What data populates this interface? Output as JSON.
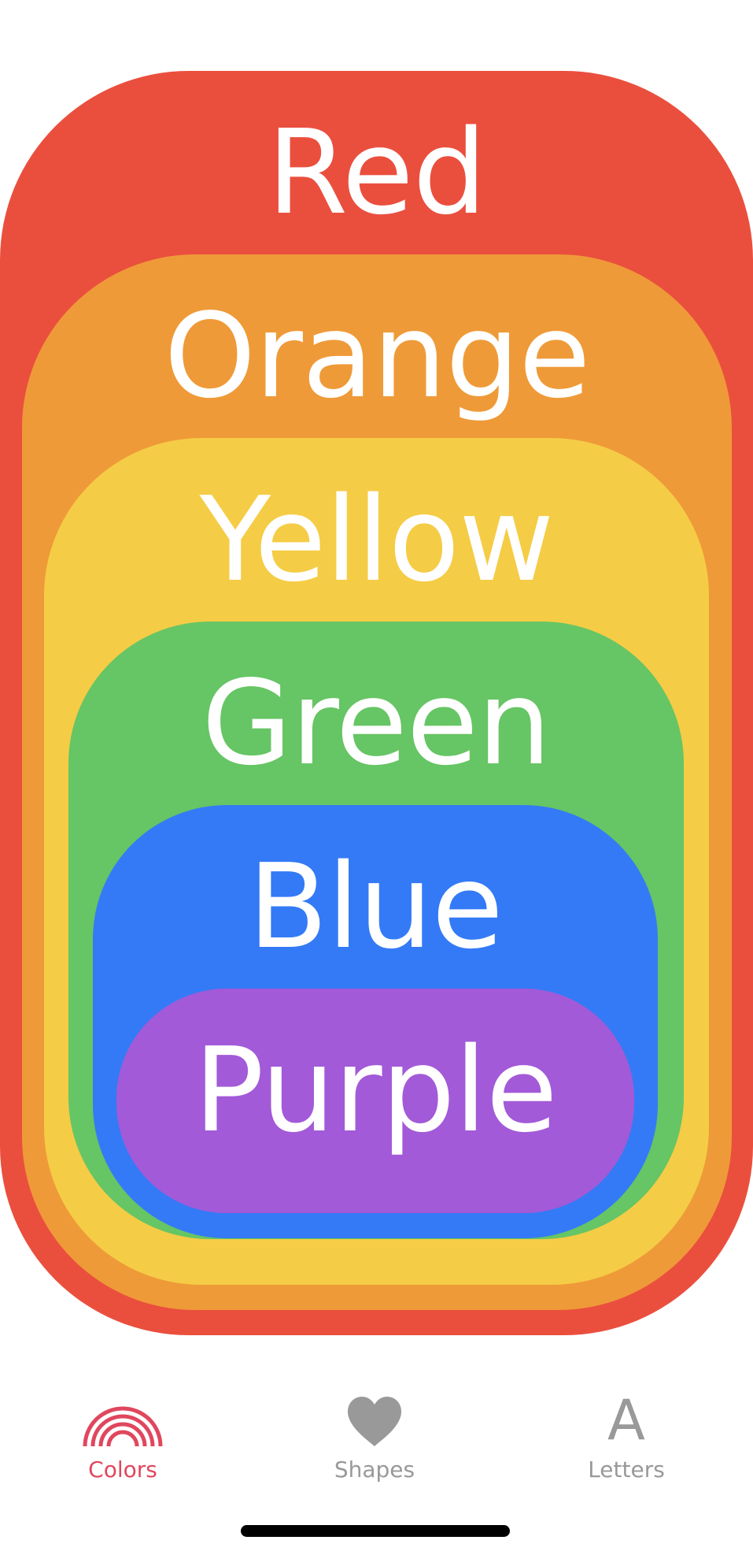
{
  "layers": [
    {
      "id": "red",
      "label": "Red",
      "color": "#EA4F3E"
    },
    {
      "id": "orange",
      "label": "Orange",
      "color": "#EF9A38"
    },
    {
      "id": "yellow",
      "label": "Yellow",
      "color": "#F5CC46"
    },
    {
      "id": "green",
      "label": "Green",
      "color": "#66C564"
    },
    {
      "id": "blue",
      "label": "Blue",
      "color": "#347AF6"
    },
    {
      "id": "purple",
      "label": "Purple",
      "color": "#A25AD8"
    }
  ],
  "tabbar": {
    "active_color": "#E0475E",
    "inactive_color": "#999999",
    "tabs": [
      {
        "label": "Colors",
        "icon": "rainbow-icon",
        "selected": true
      },
      {
        "label": "Shapes",
        "icon": "heart-icon",
        "selected": false
      },
      {
        "label": "Letters",
        "icon": "letter-a-icon",
        "glyph": "A",
        "selected": false
      }
    ]
  }
}
